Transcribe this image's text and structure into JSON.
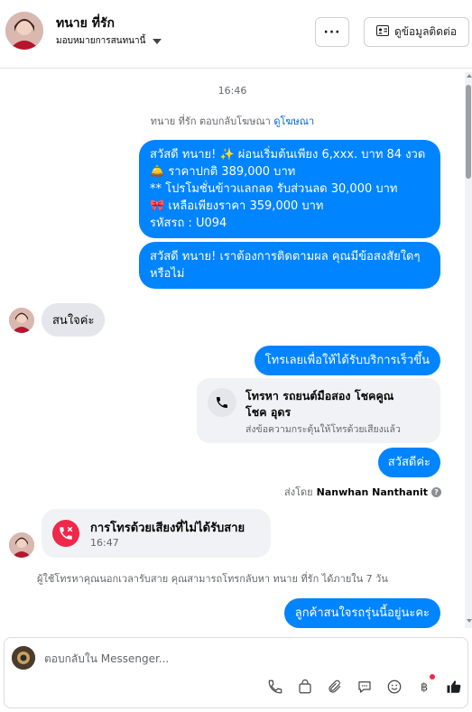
{
  "header": {
    "name": "ทนาย ที่รัก",
    "assign_label": "มอบหมายการสนทนานี้",
    "more_label": "···",
    "contact_label": "ดูข้อมูลติดต่อ"
  },
  "thread": {
    "timestamp": "16:46",
    "ad_reply_text": "ทนาย ที่รัก ตอบกลับโฆษณา",
    "ad_link": "ดูโฆษณา",
    "promo_lines": [
      "สวัสดี ทนาย! ✨  ผ่อนเริ่มต้นเพียง 6,xxx. บาท 84 งวด",
      "🛎️ ราคาปกติ 389,000 บาท",
      "** โปรโมชั่นข้าวแลกลด รับส่วนลด 30,000 บาท",
      "🎀  เหลือเพียงราคา 359,000 บาท",
      " รหัสรถ : U094"
    ],
    "followup_lines": [
      "สวัสดี ทนาย! เราต้องการติดตามผล คุณมีข้อสงสัยใดๆ",
      "หรือไม่"
    ],
    "customer_msg": "สนใจค่ะ",
    "call_prompt": "โทรเลยเพื่อให้ได้รับบริการเร็วขึ้น",
    "call_card_title_1": "โทรหา รถยนต์มือสอง โชคคูณ",
    "call_card_title_2": "โชค อุดร",
    "call_card_sub": "ส่งข้อความกระตุ้นให้โทรด้วยเสียงแล้ว",
    "greeting": "สวัสดีค่ะ",
    "sent_by_prefix": "ส่งโดย",
    "sent_by_name": "Nanwhan Nanthanit",
    "missed_call_title": "การโทรด้วยเสียงที่ไม่ได้รับสาย",
    "missed_call_time": "16:47",
    "missed_note": "ผู้ใช้โทรหาคุณนอกเวลารับสาย คุณสามารถโทรกลับหา ทนาย ที่รัก ได้ภายใน 7 วัน",
    "last_msg": "ลูกค้าสนใจรถรุ่นนี้อยู่นะคะ"
  },
  "composer": {
    "placeholder": "ตอบกลับใน Messenger..."
  },
  "colors": {
    "accent": "#0084ff",
    "missed_red": "#f02849",
    "bubble_in": "#e4e6eb",
    "meta_text": "#65676b"
  },
  "icons": [
    "phone-icon",
    "shopping-bag-icon",
    "paperclip-icon",
    "chat-bubble-icon",
    "emoji-icon",
    "baht-icon",
    "thumbs-up-icon",
    "contact-card-icon",
    "info-icon",
    "caret-down-icon"
  ]
}
